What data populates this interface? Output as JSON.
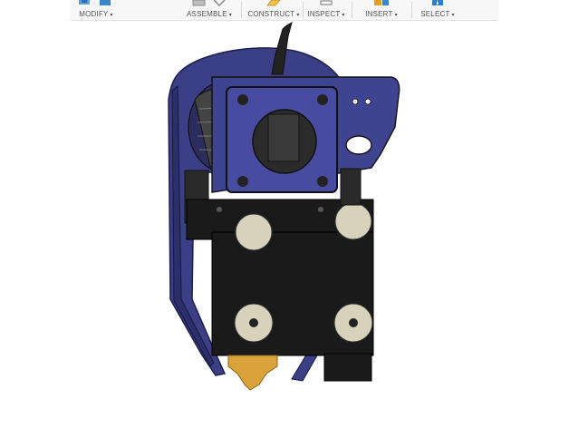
{
  "toolbar": {
    "groups": [
      {
        "label": "MODIFY",
        "icon": "modify-icons"
      },
      {
        "label": "ASSEMBLE",
        "icon": "assemble-icons"
      },
      {
        "label": "CONSTRUCT",
        "icon": "construct-icons"
      },
      {
        "label": "INSPECT",
        "icon": "inspect-icons"
      },
      {
        "label": "INSERT",
        "icon": "insert-icons"
      },
      {
        "label": "SELECT",
        "icon": "select-icons"
      }
    ],
    "caret": "▾"
  },
  "model": {
    "description_colors": {
      "shroud": "#3b3f86",
      "shroud_dark": "#26295e",
      "block": "#1a1a1a",
      "bearing": "#d8d2bd",
      "nozzle": "#d9a23a",
      "background": "#ffffff"
    }
  }
}
